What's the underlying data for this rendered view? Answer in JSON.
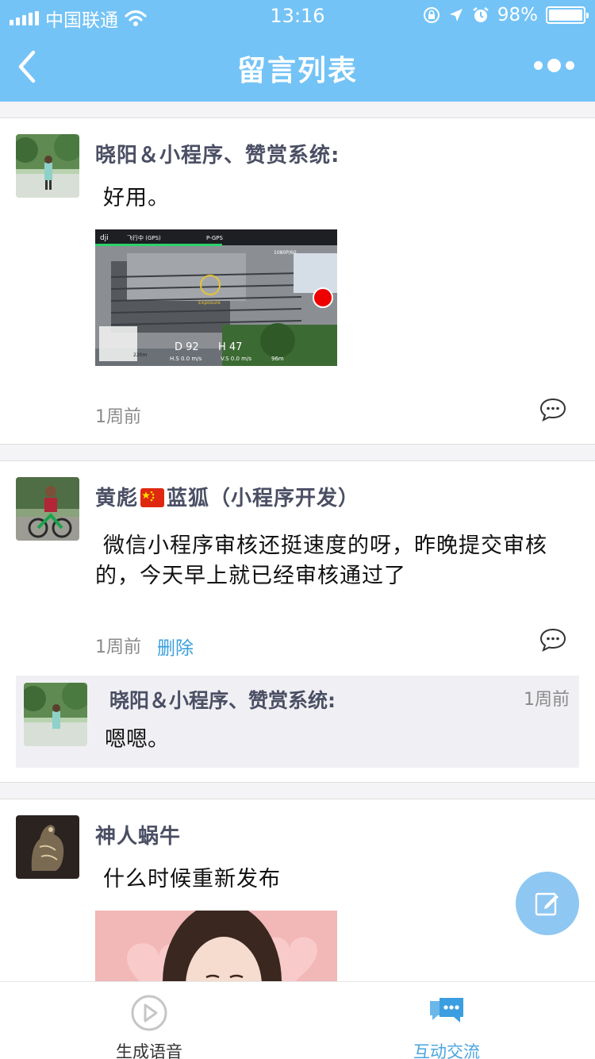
{
  "status": {
    "carrier": "中国联通",
    "time": "13:16",
    "battery": "98%",
    "battery_level": 0.98
  },
  "nav": {
    "title": "留言列表"
  },
  "posts": [
    {
      "author": "晓阳＆小程序、赞赏系统:",
      "content": "好用。",
      "time": "1周前",
      "image_desc": "drone-camera-view"
    },
    {
      "author": "黄彪",
      "author_suffix": "蓝狐（小程序开发）",
      "content": "微信小程序审核还挺速度的呀，昨晚提交审核的，今天早上就已经审核通过了",
      "time": "1周前",
      "delete_label": "删除",
      "reply": {
        "author": "晓阳＆小程序、赞赏系统:",
        "time": "1周前",
        "content": "嗯嗯。"
      }
    },
    {
      "author": "神人蜗牛",
      "content": "什么时候重新发布",
      "image_desc": "portrait-photo"
    }
  ],
  "drone_hud": {
    "mode": "飞行中 (GPS)",
    "gps": "P-GPS",
    "res": "1080P/60",
    "d": "D 92",
    "h": "H 47",
    "hs": "H.S 0.0 m/s",
    "vs": "V.S 0.0 m/s",
    "dist": "220m",
    "mini": "96m",
    "exposure": "Exposure"
  },
  "tabs": [
    {
      "label": "生成语音",
      "icon": "play-circle-icon",
      "color": "#333333"
    },
    {
      "label": "互动交流",
      "icon": "chat-bubbles-icon",
      "color": "#4aa5e0"
    }
  ],
  "colors": {
    "accent": "#74c3f6",
    "link": "#3aa0dd",
    "author": "#4b4f64",
    "fab": "#8ec7f2"
  }
}
